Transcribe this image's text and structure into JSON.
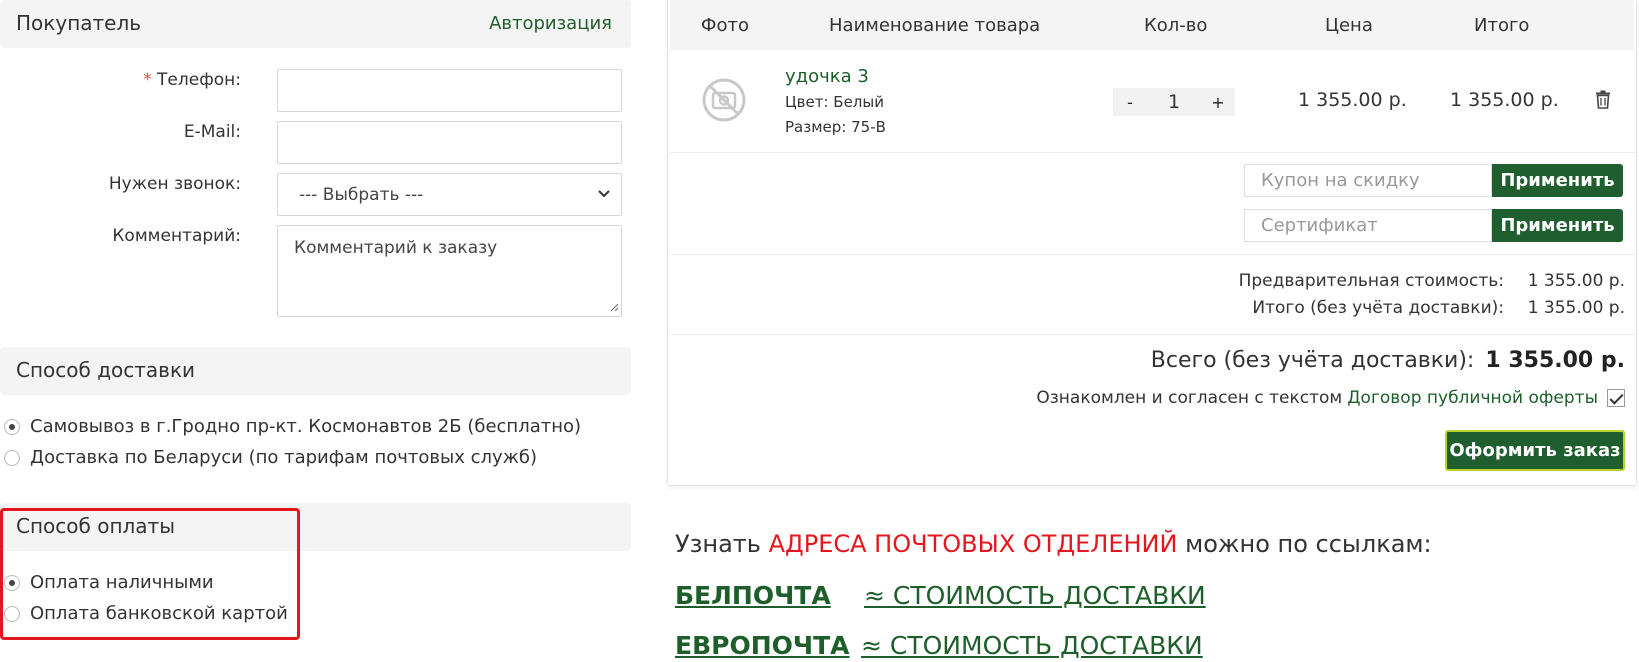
{
  "buyer": {
    "title": "Покупатель",
    "auth_link": "Авторизация",
    "required_mark": "*",
    "phone_label": "Телефон:",
    "email_label": "E-Mail:",
    "call_label": "Нужен звонок:",
    "call_select": "--- Выбрать ---",
    "comment_label": "Комментарий:",
    "comment_placeholder": "Комментарий к заказу"
  },
  "delivery": {
    "title": "Способ доставки",
    "options": [
      {
        "label": "Самовывоз в г.Гродно пр-кт. Космонавтов 2Б (бесплатно)",
        "selected": true
      },
      {
        "label": "Доставка по Беларуси (по тарифам почтовых служб)",
        "selected": false
      }
    ]
  },
  "payment": {
    "title": "Способ оплаты",
    "options": [
      {
        "label": "Оплата наличными",
        "selected": true
      },
      {
        "label": "Оплата банковской картой",
        "selected": false
      }
    ]
  },
  "cart": {
    "headers": {
      "photo": "Фото",
      "name": "Наименование товара",
      "qty": "Кол-во",
      "price": "Цена",
      "total": "Итого"
    },
    "item": {
      "name": "удочка 3",
      "color": "Цвет: Белый",
      "size": "Размер: 75-B",
      "qty_minus": "-",
      "qty": "1",
      "qty_plus": "+",
      "price": "1 355.00 р.",
      "total": "1 355.00 р."
    },
    "coupon_placeholder": "Купон на скидку",
    "certificate_placeholder": "Сертификат",
    "apply_label": "Применить",
    "subtotal_label": "Предварительная стоимость:",
    "subtotal_value": "1 355.00 р.",
    "total_label": "Итого (без учёта доставки):",
    "total_value": "1 355.00 р.",
    "grand_label": "Всего (без учёта доставки):",
    "grand_value": "1 355.00 р.",
    "agree_text": "Ознакомлен и согласен с текстом",
    "agree_link": "Договор публичной оферты",
    "agree_checked": true,
    "order_button": "Оформить заказ"
  },
  "info": {
    "prefix": "Узнать",
    "highlight": "АДРЕСА ПОЧТОВЫХ ОТДЕЛЕНИЙ",
    "suffix": "можно по ссылкам:",
    "links": [
      {
        "name": "БЕЛПОЧТА",
        "cost": "≈ СТОИМОСТЬ ДОСТАВКИ"
      },
      {
        "name": "ЕВРОПОЧТА",
        "cost": "≈ СТОИМОСТЬ ДОСТАВКИ"
      }
    ]
  },
  "colors": {
    "brand_green": "#1f5e2e",
    "link_green": "#1e5e2a",
    "highlight_red": "#e5161d",
    "section_bg": "#f4f4f4"
  },
  "icons": {
    "photo_placeholder": "no-photo-icon",
    "delete": "trash-icon",
    "select": "chevron-down-icon"
  }
}
